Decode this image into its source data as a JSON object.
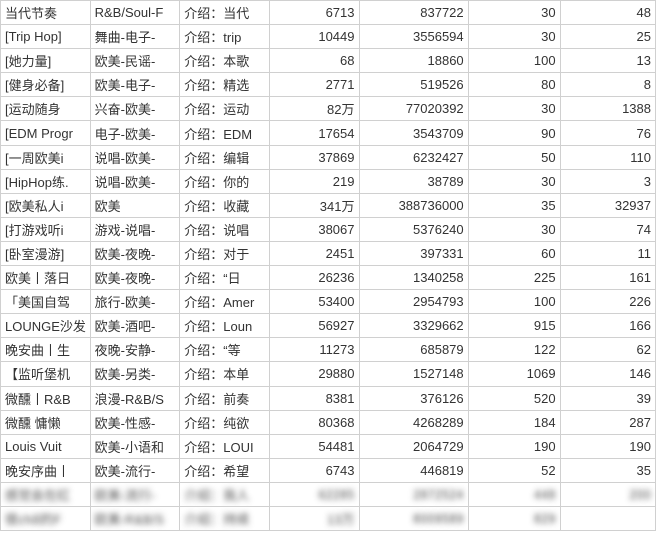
{
  "rows": [
    {
      "c0": "当代节奏",
      "c1": "R&B/Soul-F",
      "c2": "介绍：当代",
      "c3": "6713",
      "c4": "837722",
      "c5": "30",
      "c6": "48"
    },
    {
      "c0": "[Trip Hop]",
      "c1": "舞曲-电子-",
      "c2": "介绍：trip",
      "c3": "10449",
      "c4": "3556594",
      "c5": "30",
      "c6": "25"
    },
    {
      "c0": "[她力量]",
      "c1": "欧美-民谣-",
      "c2": "介绍：本歌",
      "c3": "68",
      "c4": "18860",
      "c5": "100",
      "c6": "13"
    },
    {
      "c0": "[健身必备]",
      "c1": "欧美-电子-",
      "c2": "介绍：精选",
      "c3": "2771",
      "c4": "519526",
      "c5": "80",
      "c6": "8"
    },
    {
      "c0": "[运动随身",
      "c1": "兴奋-欧美-",
      "c2": "介绍：运动",
      "c3": "82万",
      "c4": "77020392",
      "c5": "30",
      "c6": "1388"
    },
    {
      "c0": "[EDM Progr",
      "c1": "电子-欧美-",
      "c2": "介绍：EDM",
      "c3": "17654",
      "c4": "3543709",
      "c5": "90",
      "c6": "76"
    },
    {
      "c0": "[一周欧美i",
      "c1": "说唱-欧美-",
      "c2": "介绍：编辑",
      "c3": "37869",
      "c4": "6232427",
      "c5": "50",
      "c6": "110"
    },
    {
      "c0": "[HipHop练.",
      "c1": "说唱-欧美-",
      "c2": "介绍：你的",
      "c3": "219",
      "c4": "38789",
      "c5": "30",
      "c6": "3"
    },
    {
      "c0": "[欧美私人i",
      "c1": "欧美",
      "c2": "介绍：收藏",
      "c3": "341万",
      "c4": "388736000",
      "c5": "35",
      "c6": "32937"
    },
    {
      "c0": "[打游戏听i",
      "c1": "游戏-说唱-",
      "c2": "介绍：说唱",
      "c3": "38067",
      "c4": "5376240",
      "c5": "30",
      "c6": "74"
    },
    {
      "c0": "[卧室漫游]",
      "c1": "欧美-夜晚-",
      "c2": "介绍：对于",
      "c3": "2451",
      "c4": "397331",
      "c5": "60",
      "c6": "11"
    },
    {
      "c0": "欧美丨落日",
      "c1": "欧美-夜晚-",
      "c2": "介绍：“日",
      "c3": "26236",
      "c4": "1340258",
      "c5": "225",
      "c6": "161"
    },
    {
      "c0": "「美国自驾",
      "c1": "旅行-欧美-",
      "c2": "介绍：Amer",
      "c3": "53400",
      "c4": "2954793",
      "c5": "100",
      "c6": "226"
    },
    {
      "c0": "LOUNGE沙发",
      "c1": "欧美-酒吧-",
      "c2": "介绍：Loun",
      "c3": "56927",
      "c4": "3329662",
      "c5": "915",
      "c6": "166"
    },
    {
      "c0": "晚安曲丨生",
      "c1": "夜晚-安静-",
      "c2": "介绍：“等",
      "c3": "11273",
      "c4": "685879",
      "c5": "122",
      "c6": "62"
    },
    {
      "c0": "【监听堡机",
      "c1": "欧美-另类-",
      "c2": "介绍：本单",
      "c3": "29880",
      "c4": "1527148",
      "c5": "1069",
      "c6": "146"
    },
    {
      "c0": "微醺丨R&B",
      "c1": "浪漫-R&B/S",
      "c2": "介绍：前奏",
      "c3": "8381",
      "c4": "376126",
      "c5": "520",
      "c6": "39"
    },
    {
      "c0": "微醺 慵懒",
      "c1": "欧美-性感-",
      "c2": "介绍：纯欲",
      "c3": "80368",
      "c4": "4268289",
      "c5": "184",
      "c6": "287"
    },
    {
      "c0": "Louis Vuit",
      "c1": "欧美-小语和",
      "c2": "介绍：LOUI",
      "c3": "54481",
      "c4": "2064729",
      "c5": "190",
      "c6": "190"
    },
    {
      "c0": "晚安序曲丨",
      "c1": "欧美-流行-",
      "c2": "介绍：希望",
      "c3": "6743",
      "c4": "446819",
      "c5": "52",
      "c6": "35"
    },
    {
      "c0": "感觉会在红",
      "c1": "欧美-流行-",
      "c2": "介绍：我人",
      "c3": "62285",
      "c4": "2872524",
      "c5": "448",
      "c6": "200",
      "blur": true
    },
    {
      "c0": "很chill的F",
      "c1": "欧美-R&B/S",
      "c2": "介绍：持续",
      "c3": "13万",
      "c4": "8009589",
      "c5": "829",
      "c6": "",
      "blur": true
    }
  ]
}
